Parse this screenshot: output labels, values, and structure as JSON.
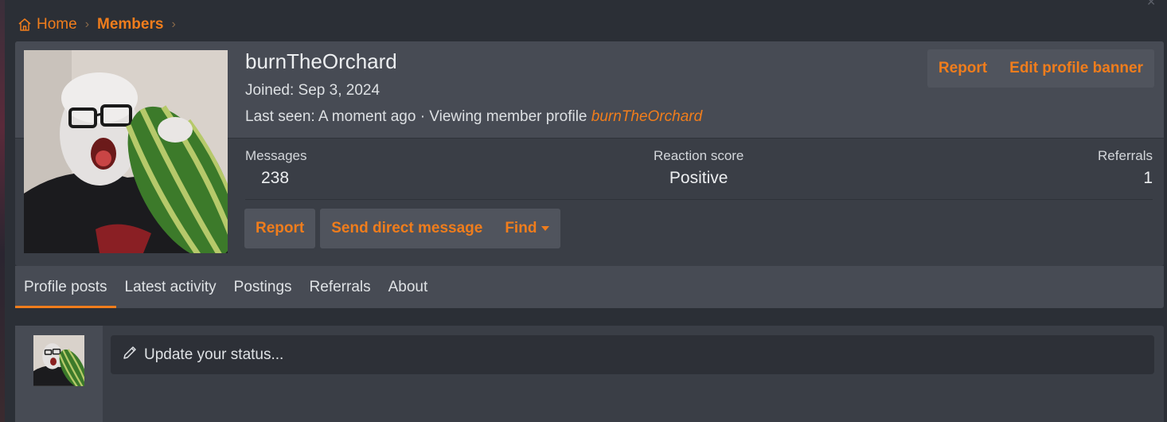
{
  "breadcrumb": {
    "home_label": "Home",
    "members_label": "Members"
  },
  "profile": {
    "username": "burnTheOrchard",
    "joined": "Joined: Sep 3, 2024",
    "last_seen_prefix": "Last seen: A moment ago · Viewing member profile ",
    "last_seen_link": "burnTheOrchard",
    "top_actions": {
      "report": "Report",
      "edit_banner": "Edit profile banner"
    },
    "stats": {
      "messages_label": "Messages",
      "messages_value": "238",
      "reaction_label": "Reaction score",
      "reaction_value": "Positive",
      "referrals_label": "Referrals",
      "referrals_value": "1"
    },
    "actions": {
      "report": "Report",
      "send_dm": "Send direct message",
      "find": "Find"
    }
  },
  "tabs": [
    {
      "label": "Profile posts",
      "active": true
    },
    {
      "label": "Latest activity",
      "active": false
    },
    {
      "label": "Postings",
      "active": false
    },
    {
      "label": "Referrals",
      "active": false
    },
    {
      "label": "About",
      "active": false
    }
  ],
  "status": {
    "placeholder": "Update your status..."
  },
  "colors": {
    "accent": "#f07d1c",
    "background": "#2b2f36",
    "card": "#3a3e46",
    "card_header": "#474b54"
  }
}
